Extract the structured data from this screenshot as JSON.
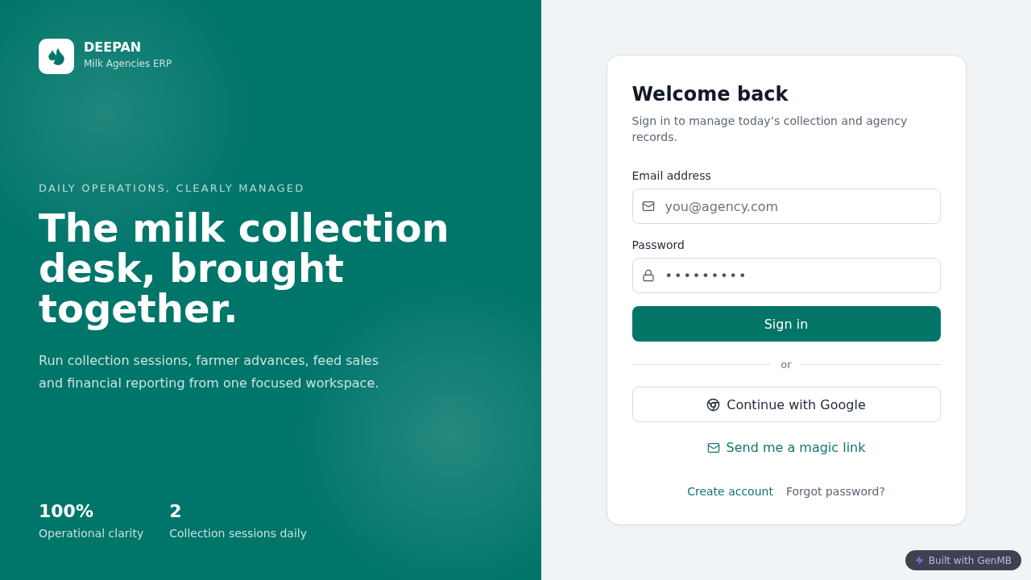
{
  "brand": {
    "name": "DEEPAN",
    "tagline": "Milk Agencies ERP"
  },
  "hero": {
    "eyebrow": "DAILY OPERATIONS, CLEARLY MANAGED",
    "headline": "The milk collection desk, brought together.",
    "description": "Run collection sessions, farmer advances, feed sales and financial reporting from one focused workspace."
  },
  "stats": [
    {
      "value": "100%",
      "label": "Operational clarity"
    },
    {
      "value": "2",
      "label": "Collection sessions daily"
    }
  ],
  "login_card": {
    "title": "Welcome back",
    "subtitle": "Sign in to manage today’s collection and agency records.",
    "fields": [
      {
        "kind": "email",
        "label": "Email address",
        "placeholder": "you@agency.com"
      },
      {
        "kind": "password",
        "label": "Password",
        "value": "•••••••••"
      }
    ],
    "submit_button": "Sign in",
    "divider": "or",
    "google_button": "Continue with Google",
    "magic_link": "Send me a magic link",
    "footer_links": [
      {
        "kind": "primary",
        "label": "Create account"
      },
      {
        "kind": "muted",
        "label": "Forgot password?"
      }
    ]
  },
  "badge": "Built with GenMB"
}
